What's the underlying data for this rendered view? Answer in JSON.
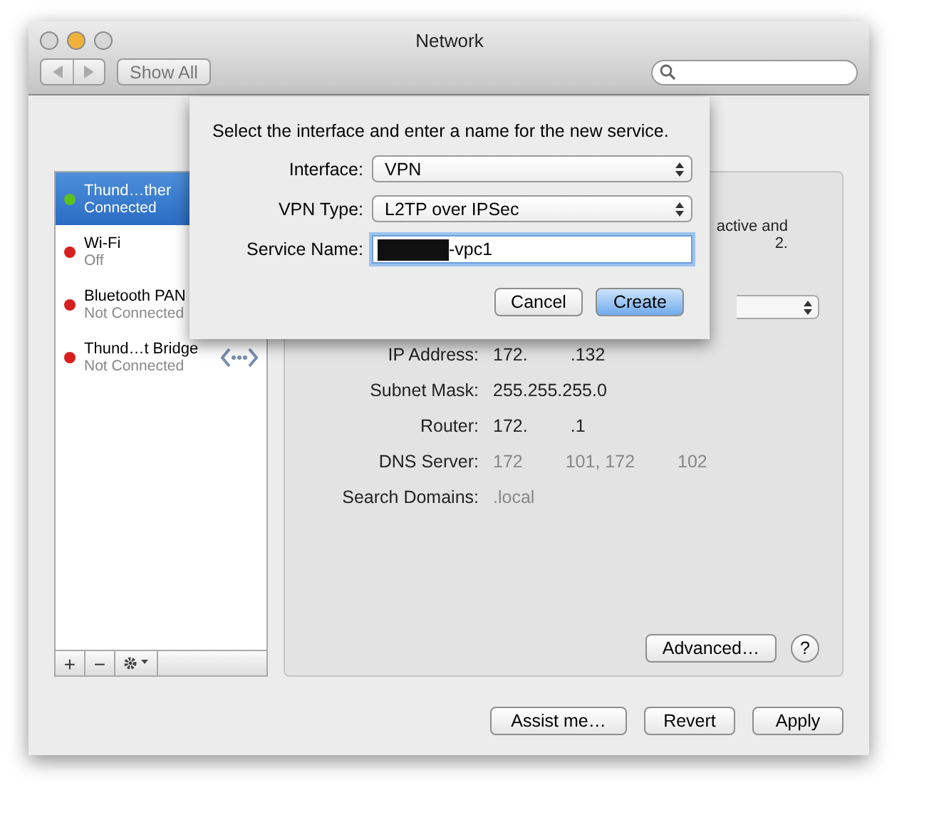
{
  "window": {
    "title": "Network"
  },
  "toolbar": {
    "show_all": "Show All"
  },
  "services": [
    {
      "name": "Thund…ther",
      "status": "Connected",
      "color": "#5cc21f",
      "selected": true,
      "kind": "plain"
    },
    {
      "name": "Wi-Fi",
      "status": "Off",
      "color": "#d81e1e",
      "selected": false,
      "kind": "plain"
    },
    {
      "name": "Bluetooth PAN",
      "status": "Not Connected",
      "color": "#d81e1e",
      "selected": false,
      "kind": "plain"
    },
    {
      "name": "Thund…t Bridge",
      "status": "Not Connected",
      "color": "#d81e1e",
      "selected": false,
      "kind": "bridge"
    }
  ],
  "list_buttons": [
    "+",
    "−"
  ],
  "status_text": [
    "active and",
    "2."
  ],
  "details": [
    {
      "label": "IP Address:",
      "parts": [
        "172.",
        ".132"
      ],
      "dim": false
    },
    {
      "label": "Subnet Mask:",
      "parts": [
        "255.255.255.0"
      ],
      "dim": false
    },
    {
      "label": "Router:",
      "parts": [
        "172.",
        ".1"
      ],
      "dim": false
    },
    {
      "label": "DNS Server:",
      "parts": [
        "172",
        "101, 172",
        "102"
      ],
      "dim": true
    },
    {
      "label": "Search Domains:",
      "parts": [
        ".local"
      ],
      "dim": true
    }
  ],
  "advanced": "Advanced…",
  "help": "?",
  "footer_buttons": [
    "Assist me…",
    "Revert",
    "Apply"
  ],
  "dialog": {
    "prompt": "Select the interface and enter a name for the new service.",
    "fields": [
      {
        "label": "Interface:",
        "kind": "popup",
        "value": "VPN"
      },
      {
        "label": "VPN Type:",
        "kind": "popup",
        "value": "L2TP over IPSec"
      },
      {
        "label": "Service Name:",
        "kind": "text",
        "value": "-vpc1"
      }
    ],
    "buttons": [
      {
        "label": "Cancel",
        "default": false
      },
      {
        "label": "Create",
        "default": true
      }
    ]
  }
}
